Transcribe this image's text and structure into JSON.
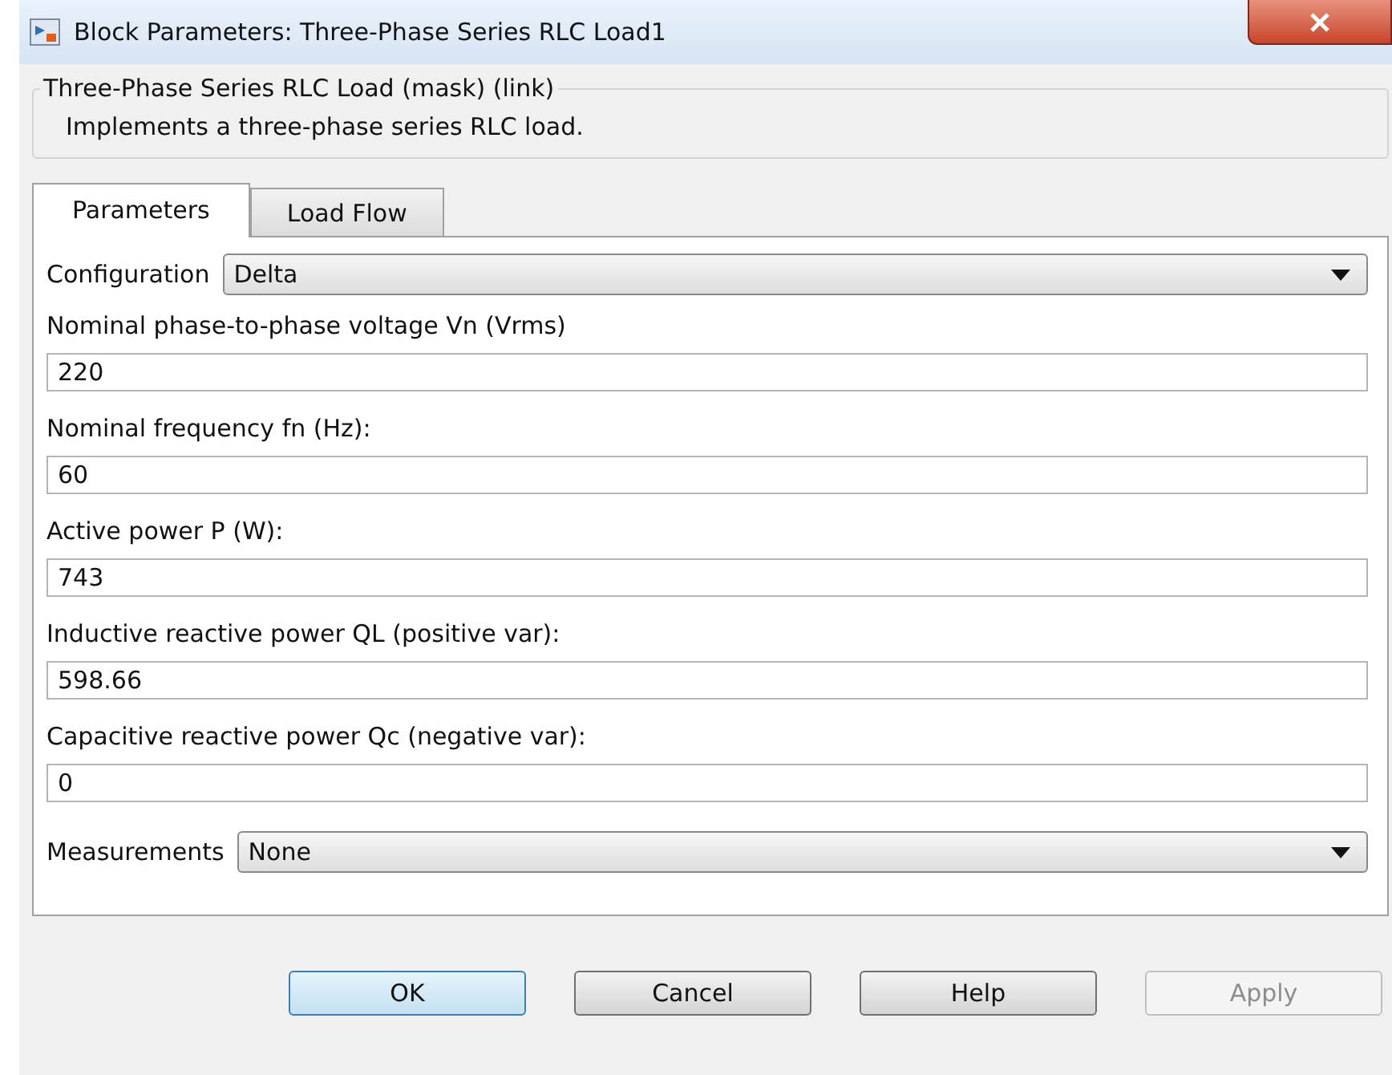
{
  "window": {
    "title": "Block Parameters: Three-Phase Series RLC Load1"
  },
  "group": {
    "title": "Three-Phase Series RLC Load (mask) (link)",
    "description": "Implements a three-phase series RLC load."
  },
  "tabs": [
    {
      "label": "Parameters",
      "selected": true
    },
    {
      "label": "Load Flow",
      "selected": false
    }
  ],
  "parameters": [
    {
      "kind": "dropdown",
      "label": "Configuration",
      "value": "Delta"
    },
    {
      "kind": "text",
      "label": "Nominal phase-to-phase voltage Vn (Vrms)",
      "value": "220"
    },
    {
      "kind": "text",
      "label": "Nominal frequency fn (Hz):",
      "value": "60"
    },
    {
      "kind": "text",
      "label": "Active power P (W):",
      "value": "743"
    },
    {
      "kind": "text",
      "label": "Inductive reactive power QL (positive var):",
      "value": "598.66"
    },
    {
      "kind": "text",
      "label": "Capacitive reactive power Qc (negative var):",
      "value": "0"
    },
    {
      "kind": "dropdown",
      "label": "Measurements",
      "value": "None"
    }
  ],
  "buttons": [
    {
      "label": "OK",
      "disabled": false,
      "default": true
    },
    {
      "label": "Cancel",
      "disabled": false,
      "default": false
    },
    {
      "label": "Help",
      "disabled": false,
      "default": false
    },
    {
      "label": "Apply",
      "disabled": true,
      "default": false
    }
  ]
}
